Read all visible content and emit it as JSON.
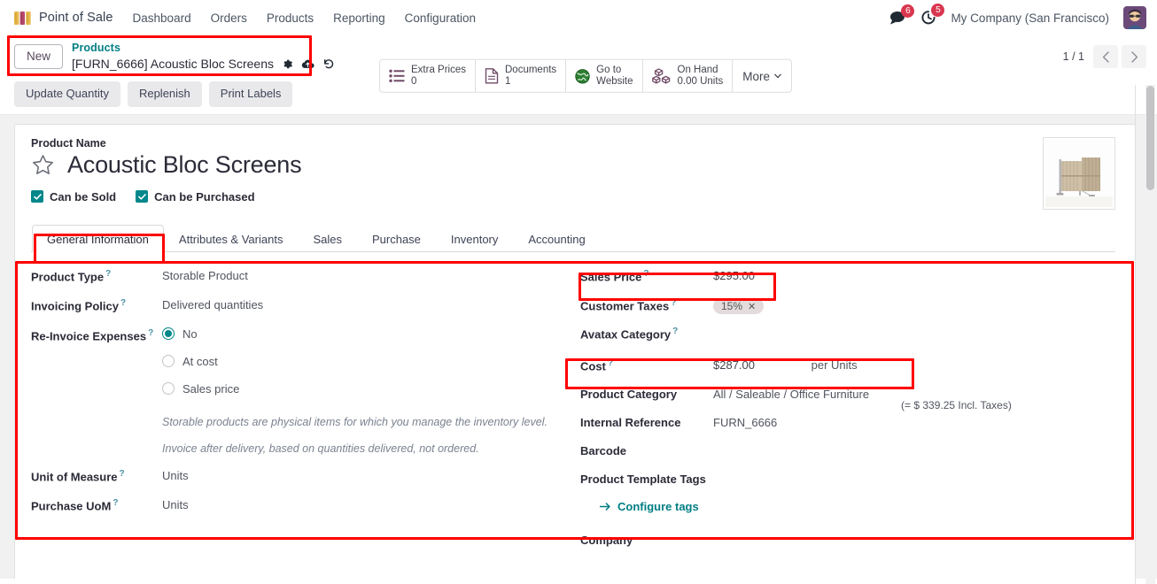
{
  "navbar": {
    "brand": "Point of Sale",
    "links": [
      "Dashboard",
      "Orders",
      "Products",
      "Reporting",
      "Configuration"
    ],
    "messages_badge": "6",
    "activities_badge": "5",
    "company": "My Company (San Francisco)"
  },
  "control_panel": {
    "new_label": "New",
    "breadcrumb_parent": "Products",
    "breadcrumb_current": "[FURN_6666] Acoustic Bloc Screens",
    "pager_count": "1 / 1"
  },
  "stat_buttons": [
    {
      "label": "Extra Prices",
      "value": "0",
      "icon": "list-icon"
    },
    {
      "label": "Documents",
      "value": "1",
      "icon": "document-icon"
    },
    {
      "label": "Go to",
      "value": "Website",
      "icon": "globe-icon"
    },
    {
      "label": "On Hand",
      "value": "0.00 Units",
      "icon": "boxes-icon"
    }
  ],
  "more_label": "More",
  "action_buttons": [
    "Update Quantity",
    "Replenish",
    "Print Labels"
  ],
  "product": {
    "name_label": "Product Name",
    "name": "Acoustic Bloc Screens",
    "can_be_sold": "Can be Sold",
    "can_be_purchased": "Can be Purchased"
  },
  "tabs": [
    {
      "label": "General Information",
      "active": true
    },
    {
      "label": "Attributes & Variants",
      "active": false
    },
    {
      "label": "Sales",
      "active": false
    },
    {
      "label": "Purchase",
      "active": false
    },
    {
      "label": "Inventory",
      "active": false
    },
    {
      "label": "Accounting",
      "active": false
    }
  ],
  "left_fields": {
    "product_type_label": "Product Type",
    "product_type_value": "Storable Product",
    "invoicing_policy_label": "Invoicing Policy",
    "invoicing_policy_value": "Delivered quantities",
    "reinvoice_label": "Re-Invoice Expenses",
    "reinvoice_options": [
      {
        "label": "No",
        "checked": true
      },
      {
        "label": "At cost",
        "checked": false
      },
      {
        "label": "Sales price",
        "checked": false
      }
    ],
    "hint_1": "Storable products are physical items for which you manage the inventory level.",
    "hint_2": "Invoice after delivery, based on quantities delivered, not ordered.",
    "uom_label": "Unit of Measure",
    "uom_value": "Units",
    "purchase_uom_label": "Purchase UoM",
    "purchase_uom_value": "Units"
  },
  "right_fields": {
    "sales_price_label": "Sales Price",
    "sales_price_value": "$295.00",
    "incl_taxes": "(= $ 339.25 Incl. Taxes)",
    "customer_taxes_label": "Customer Taxes",
    "customer_taxes_tag": "15%",
    "avatax_label": "Avatax Category",
    "avatax_value": "",
    "cost_label": "Cost",
    "cost_value": "$287.00",
    "cost_uom": "per Units",
    "category_label": "Product Category",
    "category_value": "All / Saleable / Office Furniture",
    "internal_ref_label": "Internal Reference",
    "internal_ref_value": "FURN_6666",
    "barcode_label": "Barcode",
    "barcode_value": "",
    "tags_label": "Product Template Tags",
    "configure_tags": "Configure tags",
    "company_label": "Company"
  },
  "colors": {
    "accent_teal": "#017e84",
    "annotation_red": "#ff0000",
    "badge_red": "#d9364f"
  }
}
